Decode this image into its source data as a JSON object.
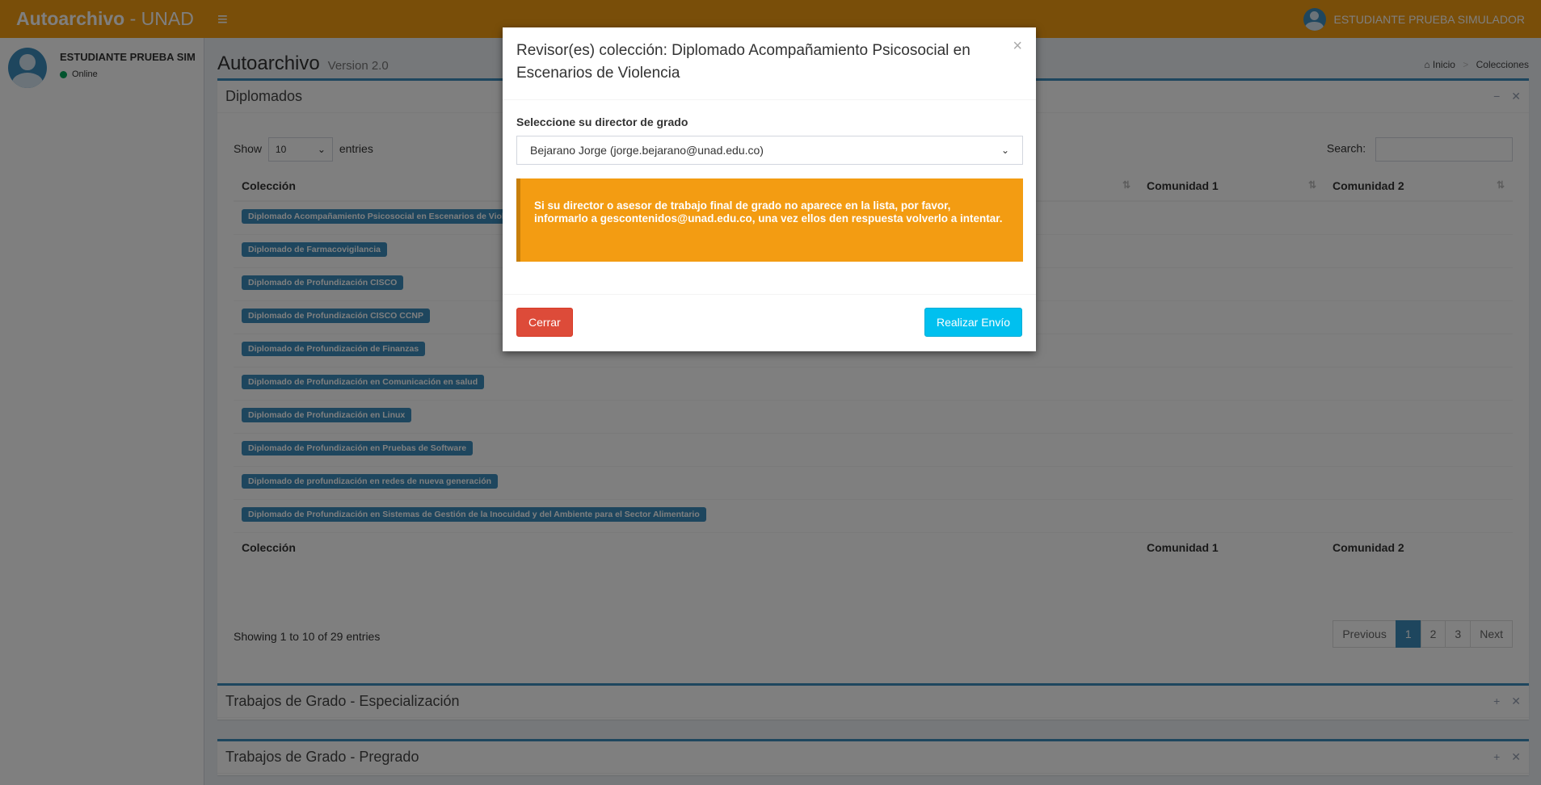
{
  "header": {
    "brand_bold": "Autoarchivo",
    "brand_rest": " - UNAD",
    "menu_icon": "hamburger-icon",
    "user_name": "ESTUDIANTE PRUEBA SIMULADOR"
  },
  "sidebar": {
    "user_name": "ESTUDIANTE PRUEBA SIMULADOR",
    "status": "Online"
  },
  "page": {
    "title": "Autoarchivo",
    "subtitle": "Version 2.0",
    "breadcrumb": [
      "Inicio",
      "Colecciones"
    ]
  },
  "diplomados": {
    "title": "Diplomados",
    "show_label": "Show",
    "entries_value": "10",
    "entries_label": "entries",
    "search_label": "Search:",
    "columns": [
      "Colección",
      "Comunidad 1",
      "Comunidad 2"
    ],
    "rows": [
      "Diplomado Acompañamiento Psicosocial en Escenarios de Violencia",
      "Diplomado de Farmacovigilancia",
      "Diplomado de Profundización CISCO",
      "Diplomado de Profundización CISCO CCNP",
      "Diplomado de Profundización de Finanzas",
      "Diplomado de Profundización en Comunicación en salud",
      "Diplomado de Profundización en Linux",
      "Diplomado de Profundización en Pruebas de Software",
      "Diplomado de profundización en redes de nueva generación",
      "Diplomado de Profundización en Sistemas de Gestión de la Inocuidad y del Ambiente para el Sector Alimentario"
    ],
    "info": "Showing 1 to 10 of 29 entries",
    "pagination": {
      "previous": "Previous",
      "pages": [
        "1",
        "2",
        "3"
      ],
      "next": "Next",
      "active": "1"
    }
  },
  "boxes": {
    "especializacion": "Trabajos de Grado - Especialización",
    "pregrado": "Trabajos de Grado - Pregrado"
  },
  "modal": {
    "title": "Revisor(es) colección: Diplomado Acompañamiento Psicosocial en Escenarios de Violencia",
    "close": "×",
    "field_label": "Seleccione su director de grado",
    "selected": "Bejarano Jorge (jorge.bejarano@unad.edu.co)",
    "callout": "Si su director o asesor de trabajo final de grado no aparece en la lista, por favor, informarlo a gescontenidos@unad.edu.co, una vez ellos den respuesta volverlo a intentar.",
    "cancel": "Cerrar",
    "submit": "Realizar Envío"
  },
  "colors": {
    "header": "#f39c12",
    "primary": "#3c8dbc",
    "danger": "#dd4b39",
    "info": "#00c0ef",
    "callout": "#f39c12"
  }
}
